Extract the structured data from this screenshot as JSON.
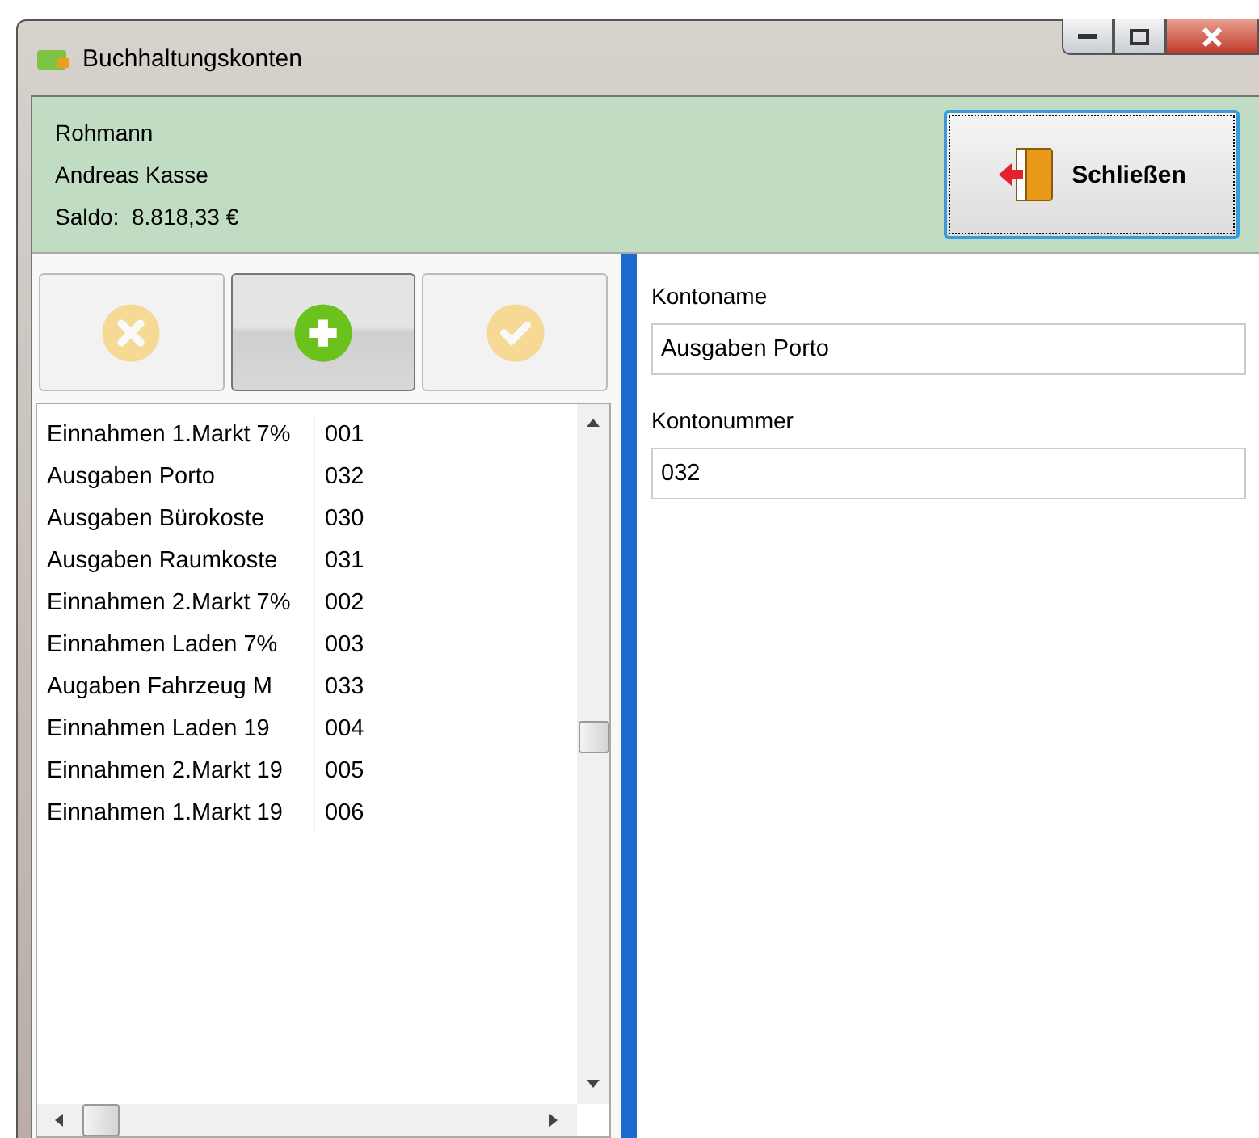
{
  "window": {
    "title": "Buchhaltungskonten"
  },
  "header": {
    "lines": [
      "Rohmann",
      "Andreas Kasse",
      "Saldo:  8.818,33 €"
    ],
    "close_button": "Schließen"
  },
  "toolbar": [
    {
      "kind": "delete",
      "disabled": true,
      "pressed": false
    },
    {
      "kind": "add",
      "disabled": false,
      "pressed": true
    },
    {
      "kind": "confirm",
      "disabled": true,
      "pressed": false
    }
  ],
  "accounts": [
    {
      "name": "Einnahmen 1.Markt 7%",
      "number": "001"
    },
    {
      "name": "Ausgaben Porto",
      "number": "032"
    },
    {
      "name": "Ausgaben Bürokoste",
      "number": "030"
    },
    {
      "name": "Ausgaben Raumkoste",
      "number": "031"
    },
    {
      "name": "Einnahmen 2.Markt 7%",
      "number": "002"
    },
    {
      "name": "Einnahmen Laden 7%",
      "number": "003"
    },
    {
      "name": "Augaben Fahrzeug M",
      "number": "033"
    },
    {
      "name": "Einnahmen Laden 19",
      "number": "004"
    },
    {
      "name": "Einnahmen 2.Markt 19",
      "number": "005"
    },
    {
      "name": "Einnahmen 1.Markt 19",
      "number": "006"
    }
  ],
  "detail": {
    "fields": [
      {
        "label": "Kontoname",
        "value": "Ausgaben Porto"
      },
      {
        "label": "Kontonummer",
        "value": "032"
      }
    ]
  }
}
